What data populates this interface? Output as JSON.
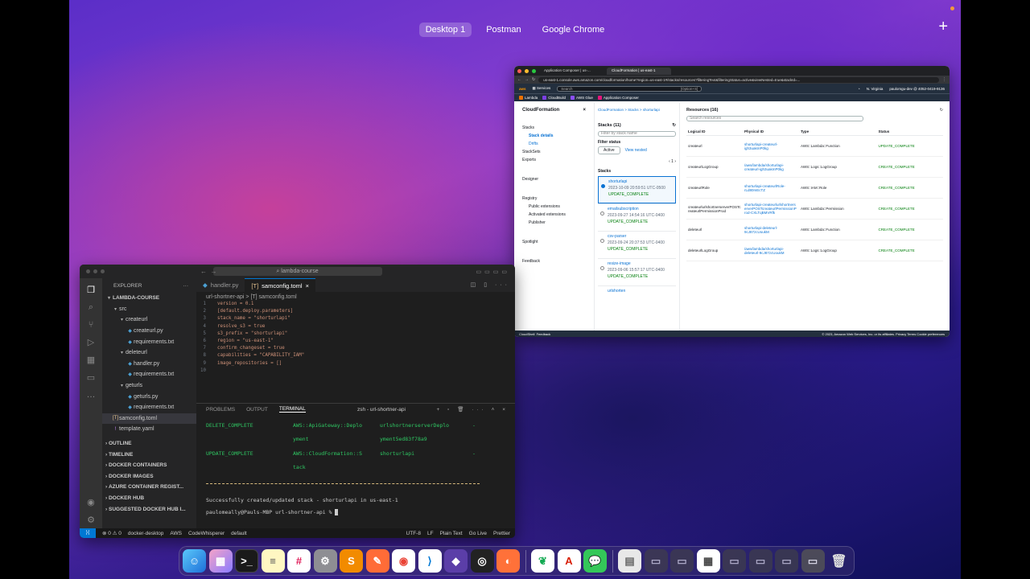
{
  "spaces": [
    "Desktop 1",
    "Postman",
    "Google Chrome"
  ],
  "browser": {
    "tabs": [
      "Application Composer | us-...",
      "CloudFormation | us-east-1"
    ],
    "url": "us-east-1.console.aws.amazon.com/cloudformation/home?region=us-east-1#/stacks/resources?filteringText&filteringStatus=active&viewNested=true&stackId=...",
    "search_placeholder": "Search",
    "search_shortcut": "[Option+S]",
    "region": "N. Virginia",
    "account": "paulomgu-dev @ 4052-0419-9136",
    "favorites": [
      "Lambda",
      "CloudBuild",
      "AWS Glue",
      "Application Composer"
    ],
    "nav_title": "CloudFormation",
    "nav_items": [
      "Stacks",
      "Stack details",
      "Drifts",
      "StackSets",
      "Exports",
      "Designer",
      "Registry",
      "Public extensions",
      "Activated extensions",
      "Publisher",
      "Spotlight",
      "Feedback"
    ],
    "breadcrumb": "CloudFormation  >  Stacks  >  shorturlapi",
    "stacks_title": "Stacks (11)",
    "stacks_filter_placeholder": "Filter by stack name",
    "filter_status_label": "Filter status",
    "filter_status_value": "Active",
    "view_nested": "View nested",
    "page": "1",
    "stacks_header": "Stacks",
    "stacks": [
      {
        "name": "shorturlapi",
        "date": "2023-10-09 20:59:51 UTC-0500",
        "status": "UPDATE_COMPLETE"
      },
      {
        "name": "emailsubscription",
        "date": "2023-09-27 14:54:16 UTC-0400",
        "status": "UPDATE_COMPLETE"
      },
      {
        "name": "csv-parser",
        "date": "2023-09-24 20:37:53 UTC-0400",
        "status": "UPDATE_COMPLETE"
      },
      {
        "name": "resize-image",
        "date": "2023-09-06 15:57:17 UTC-0400",
        "status": "UPDATE_COMPLETE"
      },
      {
        "name": "urlshorten",
        "date": "",
        "status": ""
      }
    ],
    "resources_title": "Resources (16)",
    "resources_search_placeholder": "Search resources",
    "columns": [
      "Logical ID",
      "Physical ID",
      "Type",
      "Status"
    ],
    "resources": [
      {
        "logical": "createurl",
        "physical": "shorturlapi-createurl-igh3uakmP0kg",
        "type": "AWS::Lambda::Function",
        "status": "UPDATE_COMPLETE"
      },
      {
        "logical": "createurlLogGroup",
        "physical": "/aws/lambda/shorturlapi-createurl-igh3uakmP0kg",
        "type": "AWS::Logs::LogGroup",
        "status": "CREATE_COMPLETE"
      },
      {
        "logical": "createurlRole",
        "physical": "shorturlapi-createurlRole-rLd80mEcTZ",
        "type": "AWS::IAM::Role",
        "status": "CREATE_COMPLETE"
      },
      {
        "logical": "createurlurlshortnerserverPOSTcreateurlPermissionProd",
        "physical": "shorturlapi-createurlurlshortnerserverPOSTcreateurlPermissionProd-CXLTqBMVRfk",
        "type": "AWS::Lambda::Permission",
        "status": "CREATE_COMPLETE"
      },
      {
        "logical": "deleteurl",
        "physical": "shorturlapi-deleteurl-9cJ87zcUoukM",
        "type": "AWS::Lambda::Function",
        "status": "CREATE_COMPLETE"
      },
      {
        "logical": "deleteurlLogGroup",
        "physical": "/aws/lambda/shorturlapi-deleteurl-9cJ87zcUoukM",
        "type": "AWS::Logs::LogGroup",
        "status": "CREATE_COMPLETE"
      },
      {
        "logical": "deleteurlRole",
        "physical": "shorturlapi-deleteurlRole-AJDvnmvDOOytS",
        "type": "AWS::IAM::Role",
        "status": "CREATE_COMPLETE"
      }
    ],
    "footer_left": [
      "CloudShell",
      "Feedback"
    ],
    "footer_right": "© 2023, Amazon Web Services, Inc. or its affiliates.   Privacy   Terms   Cookie preferences"
  },
  "vscode": {
    "command_center": "lambda-course",
    "explorer_label": "EXPLORER",
    "tree": [
      {
        "label": "LAMBDA-COURSE",
        "depth": 0,
        "kind": "root"
      },
      {
        "label": "src",
        "depth": 1,
        "kind": "folder"
      },
      {
        "label": "createurl",
        "depth": 2,
        "kind": "folder"
      },
      {
        "label": "createurl.py",
        "depth": 3,
        "kind": "py"
      },
      {
        "label": "requirements.txt",
        "depth": 3,
        "kind": "txt"
      },
      {
        "label": "deleteurl",
        "depth": 2,
        "kind": "folder"
      },
      {
        "label": "handler.py",
        "depth": 3,
        "kind": "py"
      },
      {
        "label": "requirements.txt",
        "depth": 3,
        "kind": "txt"
      },
      {
        "label": "geturls",
        "depth": 2,
        "kind": "folder"
      },
      {
        "label": "geturls.py",
        "depth": 3,
        "kind": "py"
      },
      {
        "label": "requirements.txt",
        "depth": 3,
        "kind": "txt"
      },
      {
        "label": "samconfig.toml",
        "depth": 1,
        "kind": "toml"
      },
      {
        "label": "template.yaml",
        "depth": 1,
        "kind": "yaml"
      }
    ],
    "sections": [
      "OUTLINE",
      "TIMELINE",
      "DOCKER CONTAINERS",
      "DOCKER IMAGES",
      "AZURE CONTAINER REGIST...",
      "DOCKER HUB",
      "SUGGESTED DOCKER HUB I..."
    ],
    "tabs": [
      "handler.py",
      "samconfig.toml"
    ],
    "editor_breadcrumb": "url-shortner-api  >  [T] samconfig.toml",
    "code": [
      "version = 0.1",
      "[default.deploy.parameters]",
      "stack_name = \"shorturlapi\"",
      "resolve_s3 = true",
      "s3_prefix = \"shorturlapi\"",
      "region = \"us-east-1\"",
      "confirm_changeset = true",
      "capabilities = \"CAPABILITY_IAM\"",
      "image_repositories = []",
      ""
    ],
    "panel_tabs": [
      "PROBLEMS",
      "OUTPUT",
      "TERMINAL"
    ],
    "terminal_name": "zsh - url-shortner-api",
    "terminal_rows": [
      [
        "DELETE_COMPLETE",
        "AWS::ApiGateway::Deplo",
        "urlshortnerserverDeplo",
        "-"
      ],
      [
        "",
        "yment",
        "yment5ed83f78a9",
        ""
      ],
      [
        "UPDATE_COMPLETE",
        "AWS::CloudFormation::S",
        "shorturlapi",
        "-"
      ],
      [
        "",
        "tack",
        "",
        ""
      ]
    ],
    "success_msg": "Successfully created/updated stack - shorturlapi in us-east-1",
    "prompt": "paulomeally@Pauls-MBP url-shortner-api % ",
    "status_left": [
      "⊗ 0 ⚠ 0",
      "⚠ 0",
      "docker-desktop",
      "AWS",
      "CodeWhisperer",
      "default"
    ],
    "status_right": [
      "UTF-8",
      "LF",
      "Plain Text",
      "Go Live",
      "Prettier"
    ]
  },
  "dock": [
    "Finder",
    "Launchpad",
    "Terminal",
    "Notes",
    "Slack",
    "System Settings",
    "Sublime Text",
    "Postman",
    "Chrome",
    "VS Code",
    "Obsidian",
    "GitHub",
    "Firefox",
    "MongoDB",
    "Acrobat",
    "Messages",
    "Preview",
    "Trash"
  ]
}
